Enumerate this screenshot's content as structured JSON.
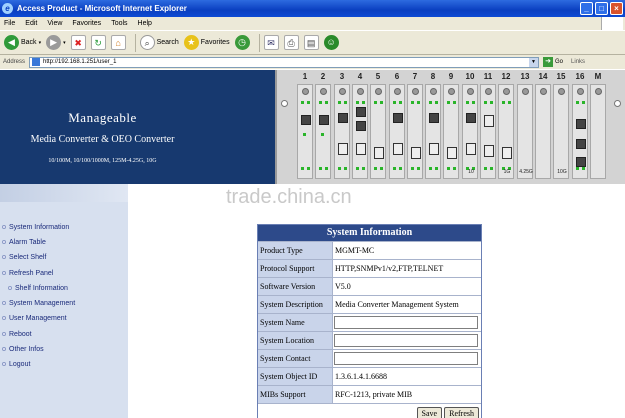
{
  "window": {
    "title": "Access Product - Microsoft Internet Explorer"
  },
  "menu": [
    "File",
    "Edit",
    "View",
    "Favorites",
    "Tools",
    "Help"
  ],
  "toolbar": {
    "back": "Back",
    "search": "Search",
    "favorites": "Favorites"
  },
  "address": {
    "label": "Address",
    "url": "http://192.168.1.251/user_1",
    "go": "Go",
    "links": "Links"
  },
  "banner": {
    "title": "Manageable",
    "subtitle": "Media Converter & OEO Converter",
    "speeds": "10/100M, 10/100/1000M, 125M-4.25G, 10G",
    "slots": [
      "1",
      "2",
      "3",
      "4",
      "5",
      "6",
      "7",
      "8",
      "9",
      "10",
      "11",
      "12",
      "13",
      "14",
      "15",
      "16",
      "M"
    ],
    "slot_labels": {
      "9": "10",
      "11": "1G",
      "12": "4.25G",
      "14": "10G"
    }
  },
  "watermark": "trade.china.cn",
  "nav": [
    "System Information",
    "Alarm Table",
    "Select Shelf",
    "Refresh Panel",
    "Shelf Information",
    "System Management",
    "User Management",
    "Reboot",
    "Other Infos",
    "Logout"
  ],
  "sysinfo": {
    "title": "System Information",
    "rows": [
      {
        "label": "Product Type",
        "value": "MGMT-MC"
      },
      {
        "label": "Protocol Support",
        "value": "HTTP,SNMPv1/v2,FTP,TELNET"
      },
      {
        "label": "Software Version",
        "value": "V5.0"
      },
      {
        "label": "System Description",
        "value": "Media Converter Management System"
      },
      {
        "label": "System Name",
        "value": ""
      },
      {
        "label": "System Location",
        "value": ""
      },
      {
        "label": "System Contact",
        "value": ""
      },
      {
        "label": "System Object ID",
        "value": "1.3.6.1.4.1.6688"
      },
      {
        "label": "MIBs Support",
        "value": "RFC-1213, private MIB"
      }
    ],
    "save": "Save",
    "refresh": "Refresh"
  }
}
